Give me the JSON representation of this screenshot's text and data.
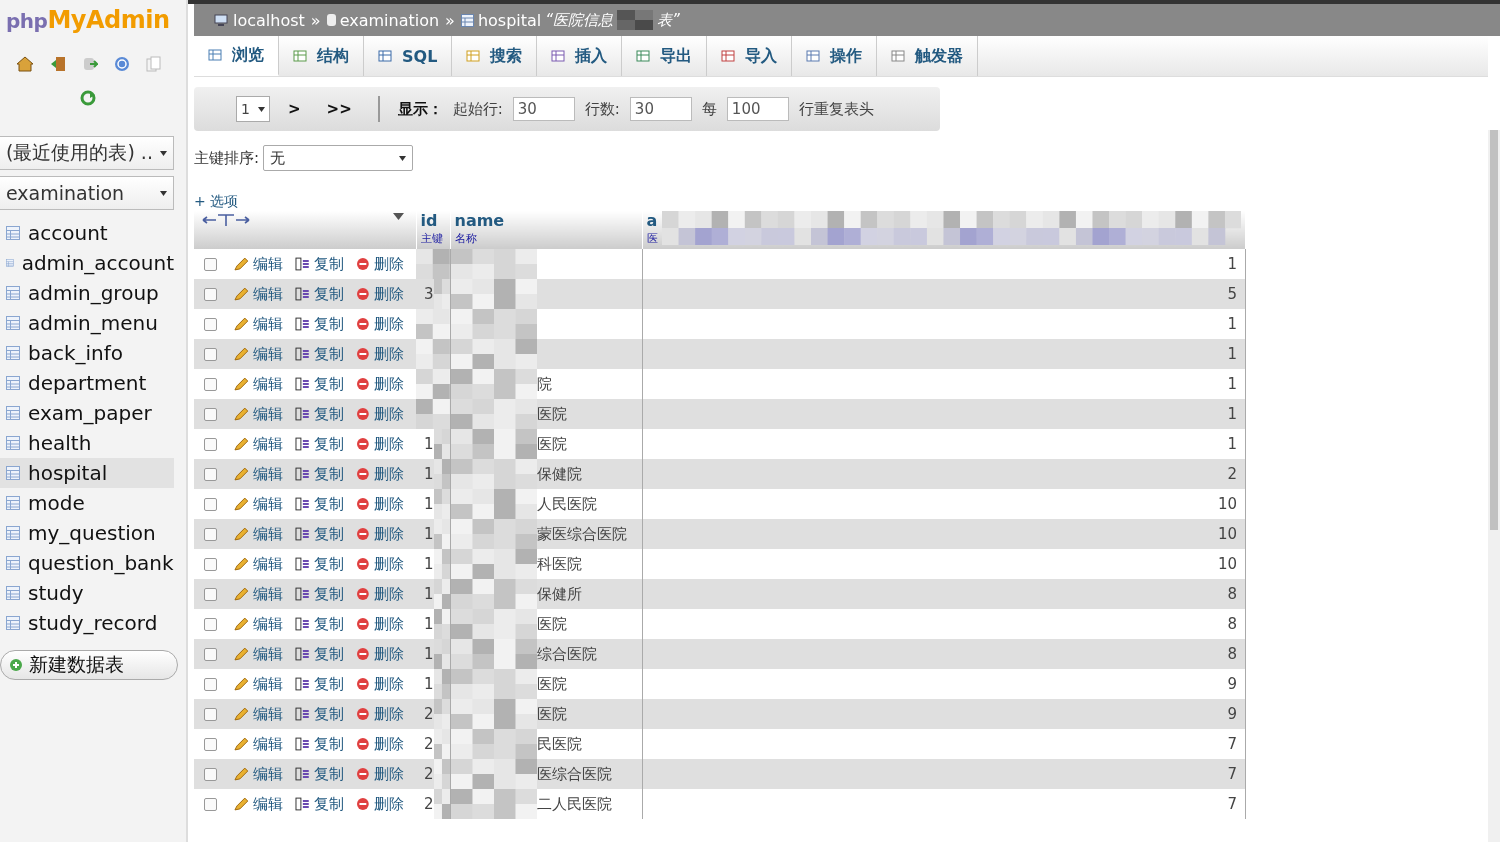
{
  "sidebar": {
    "logo": {
      "php": "php",
      "name": "MyAdmin"
    },
    "recent_select": "(最近使用的表) ..",
    "database_select": "examination",
    "tables": [
      {
        "label": "account",
        "selected": false
      },
      {
        "label": "admin_account",
        "selected": false
      },
      {
        "label": "admin_group",
        "selected": false
      },
      {
        "label": "admin_menu",
        "selected": false
      },
      {
        "label": "back_info",
        "selected": false
      },
      {
        "label": "department",
        "selected": false
      },
      {
        "label": "exam_paper",
        "selected": false
      },
      {
        "label": "health",
        "selected": false
      },
      {
        "label": "hospital",
        "selected": true
      },
      {
        "label": "mode",
        "selected": false
      },
      {
        "label": "my_question",
        "selected": false
      },
      {
        "label": "question_bank",
        "selected": false
      },
      {
        "label": "study",
        "selected": false
      },
      {
        "label": "study_record",
        "selected": false
      }
    ],
    "new_table_button": "新建数据表"
  },
  "breadcrumb": {
    "server": "localhost",
    "separator_1": "»",
    "database": "examination",
    "separator_2": "»",
    "table": "hospital",
    "comment_start": "“医院信息",
    "comment_end": "表”"
  },
  "tabs": [
    {
      "label": "浏览",
      "selected": true,
      "kind": "browse"
    },
    {
      "label": "结构",
      "selected": false,
      "kind": "structure"
    },
    {
      "label": "SQL",
      "selected": false,
      "kind": "sql"
    },
    {
      "label": "搜索",
      "selected": false,
      "kind": "search"
    },
    {
      "label": "插入",
      "selected": false,
      "kind": "insert"
    },
    {
      "label": "导出",
      "selected": false,
      "kind": "export"
    },
    {
      "label": "导入",
      "selected": false,
      "kind": "import"
    },
    {
      "label": "操作",
      "selected": false,
      "kind": "operations"
    },
    {
      "label": "触发器",
      "selected": false,
      "kind": "triggers"
    }
  ],
  "navigation": {
    "page_select": "1",
    "next": ">",
    "last": ">>",
    "show_label": "显示：",
    "start_label": "起始行:",
    "start_value": "30",
    "rows_label": "行数:",
    "rows_value": "30",
    "every_label": "每",
    "every_value": "100",
    "repeat_label": "行重复表头"
  },
  "sort": {
    "label": "主键排序:",
    "value": "无"
  },
  "options_link": "+ 选项",
  "table": {
    "columns": [
      {
        "name": "id",
        "comment": "主键"
      },
      {
        "name": "name",
        "comment": "名称"
      },
      {
        "name": "a",
        "comment": "医"
      }
    ],
    "rows": [
      {
        "checked": false,
        "edit": "编辑",
        "copy": "复制",
        "delete": "删除",
        "value": "1"
      },
      {
        "checked": false,
        "edit": "编辑",
        "copy": "复制",
        "delete": "删除",
        "id": "3",
        "value": "5"
      },
      {
        "checked": false,
        "edit": "编辑",
        "copy": "复制",
        "delete": "删除",
        "value": "1"
      },
      {
        "checked": false,
        "edit": "编辑",
        "copy": "复制",
        "delete": "删除",
        "value": "1"
      },
      {
        "checked": false,
        "edit": "编辑",
        "copy": "复制",
        "delete": "删除",
        "name": "院",
        "value": "1"
      },
      {
        "checked": false,
        "edit": "编辑",
        "copy": "复制",
        "delete": "删除",
        "name": "医院",
        "value": "1"
      },
      {
        "checked": false,
        "edit": "编辑",
        "copy": "复制",
        "delete": "删除",
        "id": "1",
        "name": "医院",
        "value": "1"
      },
      {
        "checked": false,
        "edit": "编辑",
        "copy": "复制",
        "delete": "删除",
        "id": "1",
        "name": "保健院",
        "value": "2"
      },
      {
        "checked": false,
        "edit": "编辑",
        "copy": "复制",
        "delete": "删除",
        "id": "1",
        "name": "人民医院",
        "value": "10"
      },
      {
        "checked": false,
        "edit": "编辑",
        "copy": "复制",
        "delete": "删除",
        "id": "1",
        "name": "蒙医综合医院",
        "value": "10"
      },
      {
        "checked": false,
        "edit": "编辑",
        "copy": "复制",
        "delete": "删除",
        "id": "1",
        "name": "科医院",
        "value": "10"
      },
      {
        "checked": false,
        "edit": "编辑",
        "copy": "复制",
        "delete": "删除",
        "id": "1",
        "name": "保健所",
        "value": "8"
      },
      {
        "checked": false,
        "edit": "编辑",
        "copy": "复制",
        "delete": "删除",
        "id": "1",
        "name": "医院",
        "value": "8"
      },
      {
        "checked": false,
        "edit": "编辑",
        "copy": "复制",
        "delete": "删除",
        "id": "1",
        "name": "综合医院",
        "value": "8"
      },
      {
        "checked": false,
        "edit": "编辑",
        "copy": "复制",
        "delete": "删除",
        "id": "1",
        "name": "医院",
        "value": "9"
      },
      {
        "checked": false,
        "edit": "编辑",
        "copy": "复制",
        "delete": "删除",
        "id": "2",
        "name": "医院",
        "value": "9"
      },
      {
        "checked": false,
        "edit": "编辑",
        "copy": "复制",
        "delete": "删除",
        "id": "2",
        "name": "民医院",
        "value": "7"
      },
      {
        "checked": false,
        "edit": "编辑",
        "copy": "复制",
        "delete": "删除",
        "id": "2",
        "name": "医综合医院",
        "value": "7"
      },
      {
        "checked": false,
        "edit": "编辑",
        "copy": "复制",
        "delete": "删除",
        "id": "2",
        "name": "二人民医院",
        "value": "7"
      }
    ]
  }
}
